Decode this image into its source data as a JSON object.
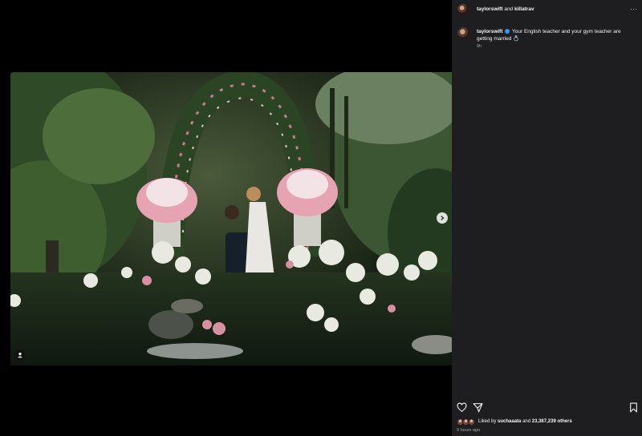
{
  "header": {
    "user1": "taylorswift",
    "and": "and",
    "user2": "killatrav",
    "more": "···"
  },
  "caption": {
    "username": "taylorswift",
    "text": "Your English teacher and your gym teacher are getting married",
    "emoji": "💍",
    "time": "9h"
  },
  "post": {
    "likes_prefix": "Liked by",
    "liked_by_user": "suchaaata",
    "likes_and": "and",
    "likes_count": "23,387,239 others",
    "time": "9 hours ago"
  },
  "icons": {
    "like": "heart-icon",
    "share": "send-icon",
    "save": "bookmark-icon",
    "next": "chevron-right-icon",
    "tag": "person-tag-icon",
    "verified": "verified-badge-icon"
  },
  "colors": {
    "background": "#000000",
    "sidebar": "#1e1e21",
    "verified": "#3897f0",
    "muted_text": "#a8a8a8"
  }
}
